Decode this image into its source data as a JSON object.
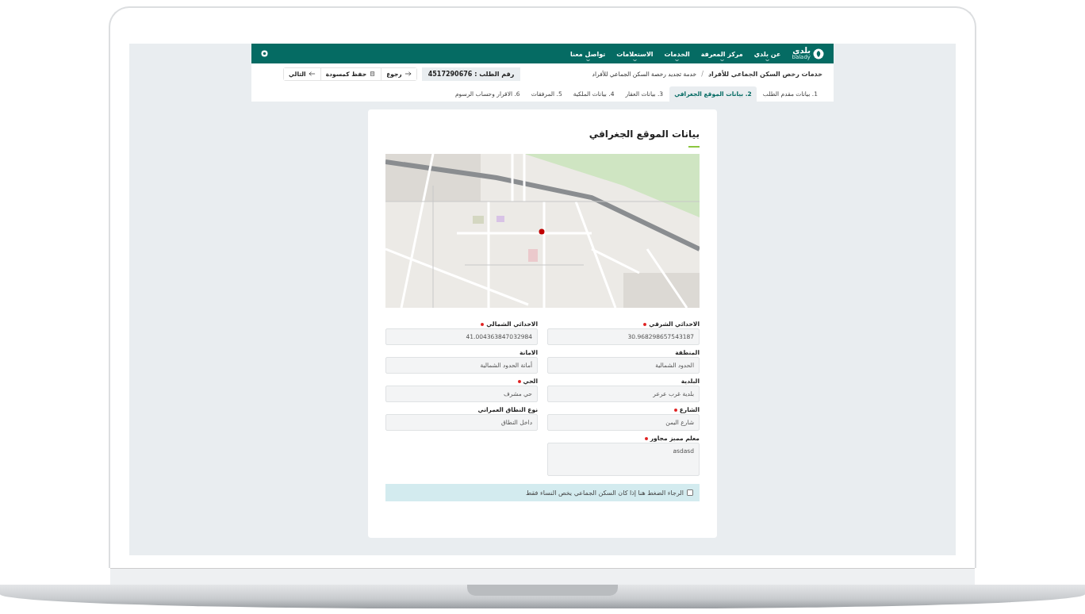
{
  "header": {
    "logo_text": "بلدي",
    "logo_subtext": "balady",
    "nav": [
      {
        "label": "عن بلدي"
      },
      {
        "label": "مركز المعرفة"
      },
      {
        "label": "الخدمات"
      },
      {
        "label": "الاستعلامات"
      },
      {
        "label": "تواصل معنا"
      }
    ]
  },
  "breadcrumb_separator": "/",
  "breadcrumb": [
    "خدمات رخص السكن الجماعي للأفراد",
    "خدمة تجديد رخصة السكن الجماعي للأفراد"
  ],
  "request_number": "رقم الطلب : 4517290676",
  "actions": [
    {
      "kind": "back",
      "label": "رجوع"
    },
    {
      "kind": "save",
      "label": "حفظ كمسودة"
    },
    {
      "kind": "next",
      "label": "التالي"
    }
  ],
  "steps": [
    {
      "number": "1.",
      "label": "بيانات مقدم الطلب",
      "selected": false
    },
    {
      "number": "2.",
      "label": "بيانات الموقع الجغرافي",
      "selected": true
    },
    {
      "number": "3.",
      "label": "بيانات العقار",
      "selected": false
    },
    {
      "number": "4.",
      "label": "بيانات الملكية",
      "selected": false
    },
    {
      "number": "5.",
      "label": "المرفقات",
      "selected": false
    },
    {
      "number": "6.",
      "label": "الاقرار وحساب الرسوم",
      "selected": false
    }
  ],
  "card": {
    "title": "بيانات الموقع الجغرافي",
    "fields": [
      {
        "kind": "text",
        "label": "الاحداثي الشرقي",
        "required": true,
        "value": "30.968298657543187"
      },
      {
        "kind": "text",
        "label": "الاحداثي الشمالي",
        "required": true,
        "value": "41.004363847032984"
      },
      {
        "kind": "text",
        "label": "المنطقة",
        "required": false,
        "value": "الحدود الشمالية"
      },
      {
        "kind": "text",
        "label": "الامانة",
        "required": false,
        "value": "أمانة الحدود الشمالية"
      },
      {
        "kind": "text",
        "label": "البلدية",
        "required": false,
        "value": "بلدية غرب عرعر"
      },
      {
        "kind": "text",
        "label": "الحي",
        "required": true,
        "value": "حي مشرف"
      },
      {
        "kind": "text",
        "label": "الشارع",
        "required": true,
        "value": "شارع اليمن"
      },
      {
        "kind": "text",
        "label": "نوع النطاق العمراني",
        "required": false,
        "value": "داخل النطاق"
      },
      {
        "kind": "textarea",
        "label": "معلم مميز مجاور",
        "required": true,
        "value": "asdasd"
      }
    ],
    "checkbox": {
      "label": "الرجاء الضغط هنا إذا كان السكن الجماعي يخص النساء فقط",
      "checked": false
    }
  }
}
